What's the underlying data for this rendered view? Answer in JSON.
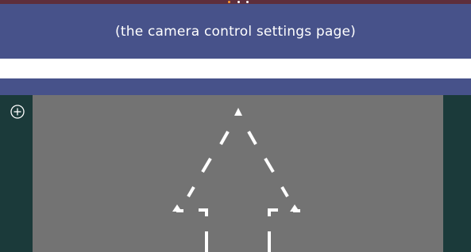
{
  "header": {
    "caption": "(the camera control settings page)",
    "page_dots": {
      "count": 3,
      "active_index": 0
    }
  },
  "controls": {
    "add_icon": "plus-circle-icon"
  },
  "camera_view": {
    "overlay_icon": "dashed-up-arrow-icon"
  },
  "colors": {
    "top_strip": "#5e2e3c",
    "header_band": "#47528a",
    "side_rail": "#1b3a3a",
    "viewport": "#737373",
    "active_dot": "#ff9a2e",
    "overlay": "#ffffff"
  }
}
